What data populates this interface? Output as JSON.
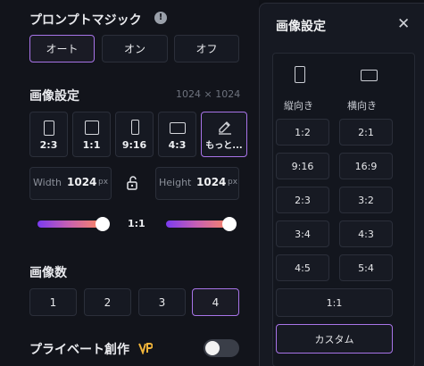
{
  "prompt_magic": {
    "title": "プロンプトマジック",
    "info_icon": "info-icon",
    "options": [
      "オート",
      "オン",
      "オフ"
    ],
    "selected": "オート"
  },
  "image_settings": {
    "title": "画像設定",
    "size_display": "1024 × 1024",
    "ratios": [
      {
        "label": "2:3",
        "icon": "portrait-icon"
      },
      {
        "label": "1:1",
        "icon": "square-icon"
      },
      {
        "label": "9:16",
        "icon": "tall-portrait-icon"
      },
      {
        "label": "4:3",
        "icon": "landscape-icon"
      },
      {
        "label": "もっと...",
        "icon": "edit-pencil-icon"
      }
    ],
    "selected_ratio": "もっと...",
    "width_label": "Width",
    "width_value": "1024",
    "height_label": "Height",
    "height_value": "1024",
    "unit": "px",
    "lock_icon": "unlock-icon",
    "ratio_readout": "1:1"
  },
  "image_count": {
    "title": "画像数",
    "options": [
      "1",
      "2",
      "3",
      "4"
    ],
    "selected": "4"
  },
  "private": {
    "title": "プライベート創作",
    "badge_icon": "vip-badge-icon",
    "enabled": false
  },
  "panel": {
    "title": "画像設定",
    "close_icon": "close-icon",
    "portrait_label": "縦向き",
    "landscape_label": "横向き",
    "ratios": [
      "1:2",
      "2:1",
      "9:16",
      "16:9",
      "2:3",
      "3:2",
      "3:4",
      "4:3",
      "4:5",
      "5:4"
    ],
    "square": "1:1",
    "custom": "カスタム"
  },
  "colors": {
    "accent": "#a874e8",
    "background": "#12141b",
    "slider_start": "#7b3bf0",
    "slider_end": "#ff8a5c"
  }
}
